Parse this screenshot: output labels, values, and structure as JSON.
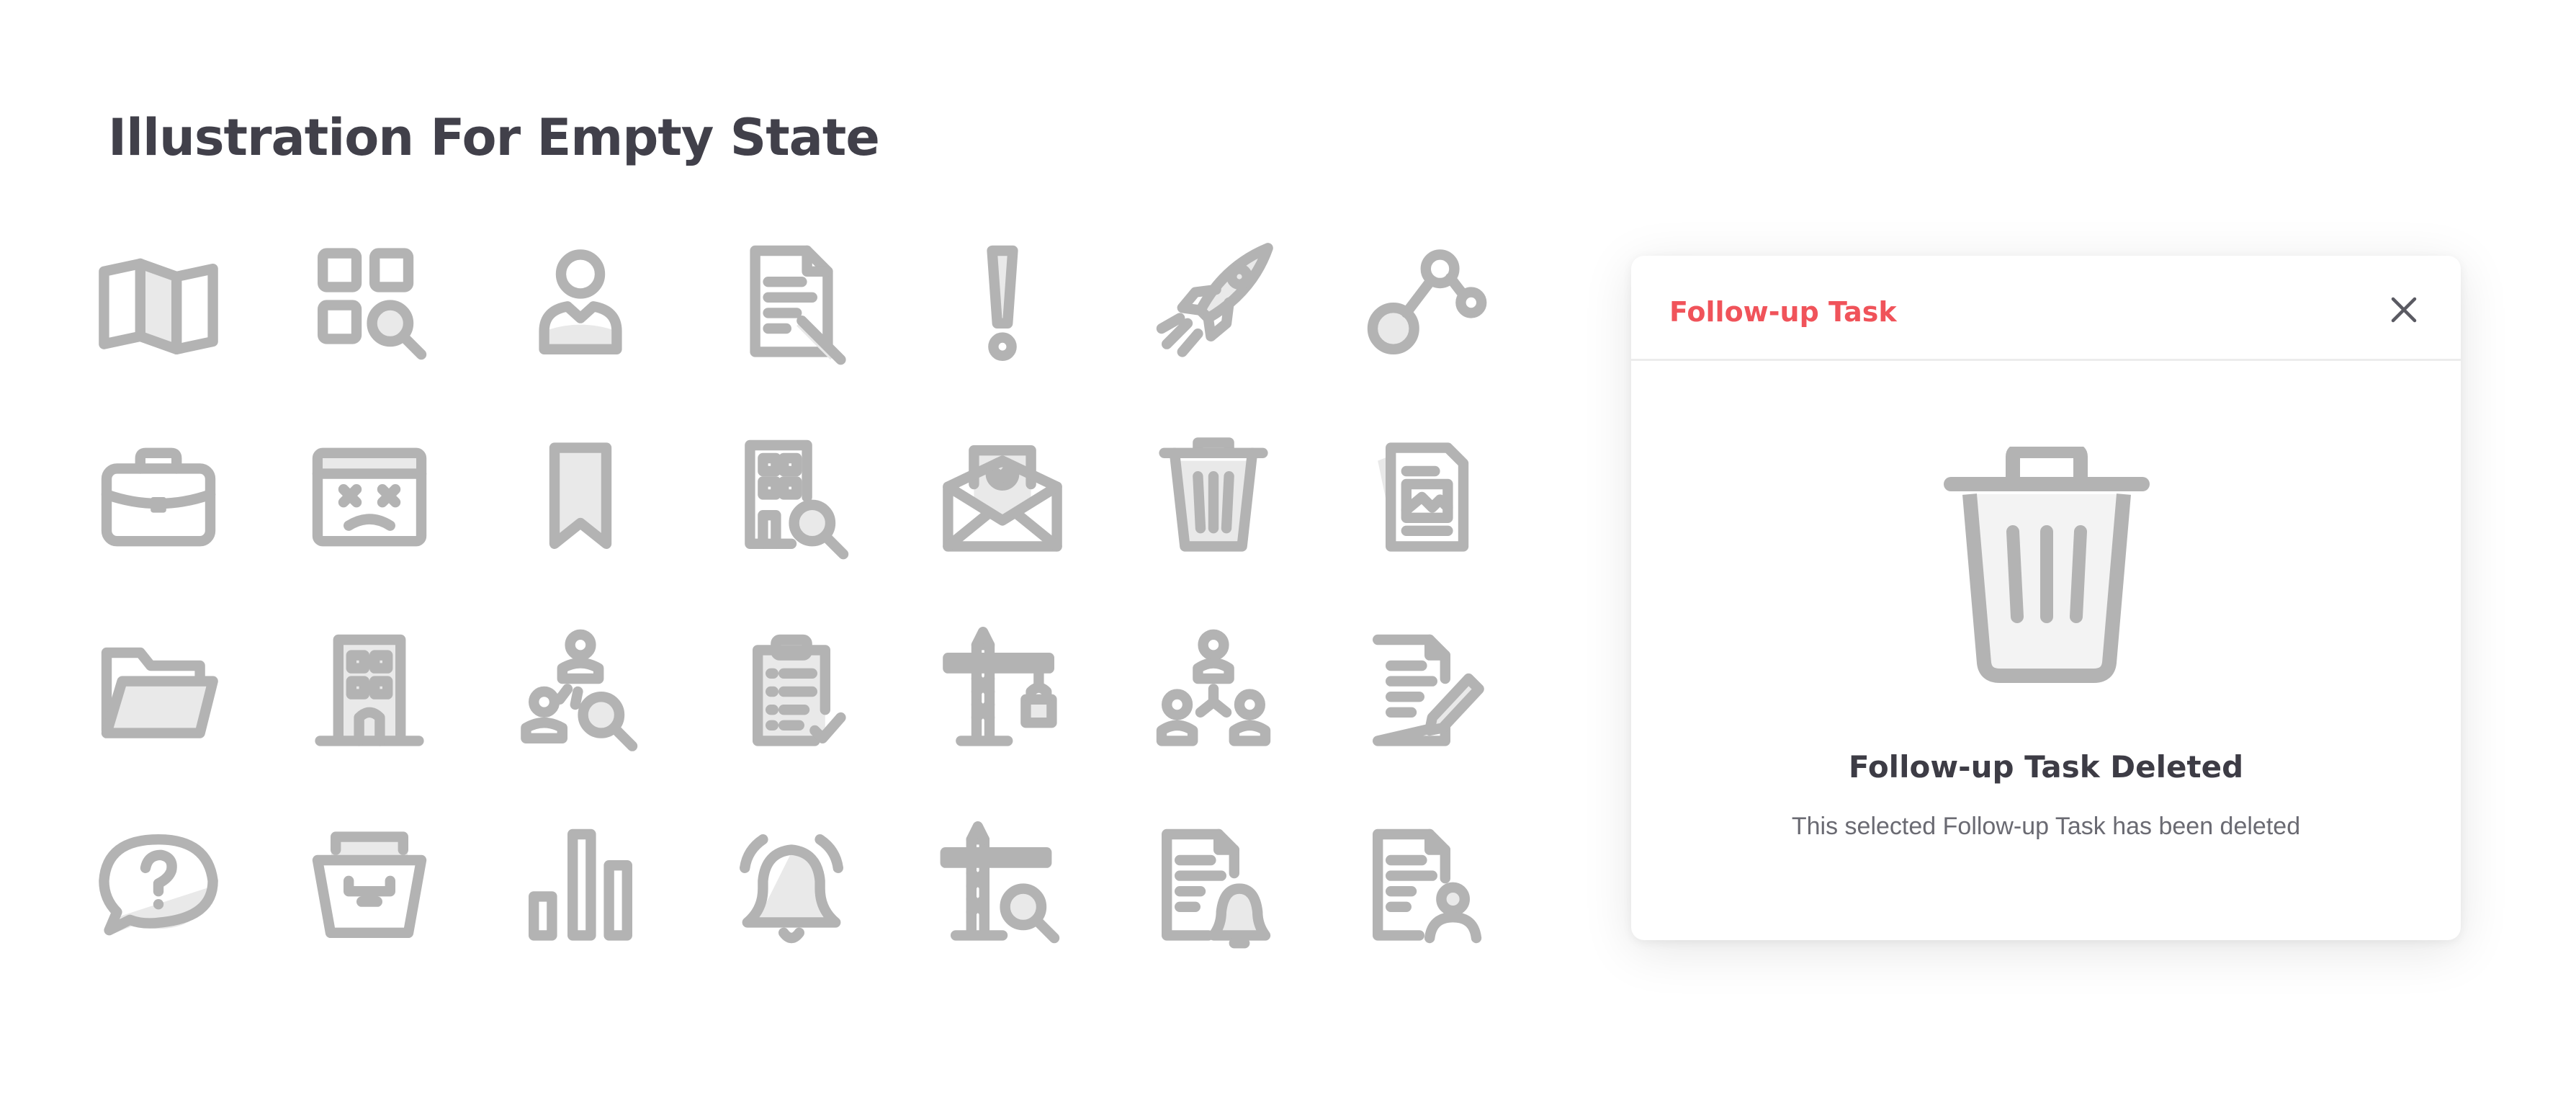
{
  "page": {
    "title": "Illustration For Empty State"
  },
  "icons": [
    "map-icon",
    "grid-search-icon",
    "user-icon",
    "document-edit-icon",
    "exclamation-icon",
    "rocket-icon",
    "share-nodes-icon",
    "briefcase-icon",
    "browser-error-icon",
    "bookmark-icon",
    "building-search-icon",
    "email-check-icon",
    "trash-icon",
    "image-document-icon",
    "folder-open-icon",
    "building-icon",
    "team-search-icon",
    "clipboard-check-icon",
    "crane-lock-icon",
    "org-chart-icon",
    "document-pencil-icon",
    "chat-question-icon",
    "archive-box-icon",
    "bar-chart-icon",
    "bell-icon",
    "crane-search-icon",
    "document-bell-icon",
    "document-user-icon"
  ],
  "modal": {
    "title": "Follow-up Task",
    "heading": "Follow-up Task Deleted",
    "message": "This selected Follow-up Task has been deleted",
    "illustration": "trash-icon",
    "close_icon": "close-icon"
  },
  "colors": {
    "accent": "#f0535a",
    "icon_stroke": "#b3b3b3",
    "heading": "#3d3c45",
    "title": "#41404a",
    "muted_text": "#6a6a72"
  }
}
